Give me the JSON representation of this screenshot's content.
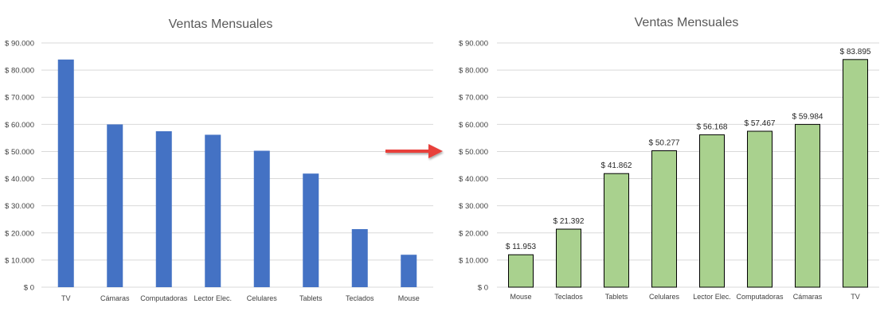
{
  "chart_data": [
    {
      "type": "bar",
      "title": "Ventas Mensuales",
      "categories": [
        "TV",
        "Cámaras",
        "Computadoras",
        "Lector Elec.",
        "Celulares",
        "Tablets",
        "Teclados",
        "Mouse"
      ],
      "values": [
        83895,
        59984,
        57467,
        56168,
        50277,
        41862,
        21392,
        11953
      ],
      "ylim": [
        0,
        90000
      ],
      "yticks": [
        0,
        10000,
        20000,
        30000,
        40000,
        50000,
        60000,
        70000,
        80000,
        90000
      ],
      "ytick_labels": [
        "$ 0",
        "$ 10.000",
        "$ 20.000",
        "$ 30.000",
        "$ 40.000",
        "$ 50.000",
        "$ 60.000",
        "$ 70.000",
        "$ 80.000",
        "$ 90.000"
      ],
      "grid": true,
      "bar_color": "#4472c4",
      "data_labels": false
    },
    {
      "type": "bar",
      "title": "Ventas Mensuales",
      "categories": [
        "Mouse",
        "Teclados",
        "Tablets",
        "Celulares",
        "Lector Elec.",
        "Computadoras",
        "Cámaras",
        "TV"
      ],
      "values": [
        11953,
        21392,
        41862,
        50277,
        56168,
        57467,
        59984,
        83895
      ],
      "value_labels": [
        "$ 11.953",
        "$ 21.392",
        "$ 41.862",
        "$ 50.277",
        "$ 56.168",
        "$ 57.467",
        "$ 59.984",
        "$ 83.895"
      ],
      "ylim": [
        0,
        90000
      ],
      "yticks": [
        0,
        10000,
        20000,
        30000,
        40000,
        50000,
        60000,
        70000,
        80000,
        90000
      ],
      "ytick_labels": [
        "$ 0",
        "$ 10.000",
        "$ 20.000",
        "$ 30.000",
        "$ 40.000",
        "$ 50.000",
        "$ 60.000",
        "$ 70.000",
        "$ 80.000",
        "$ 90.000"
      ],
      "grid": true,
      "bar_color": "#a9d18e",
      "bar_border": "#000000",
      "data_labels": true
    }
  ],
  "arrow_color": "#e8413a"
}
